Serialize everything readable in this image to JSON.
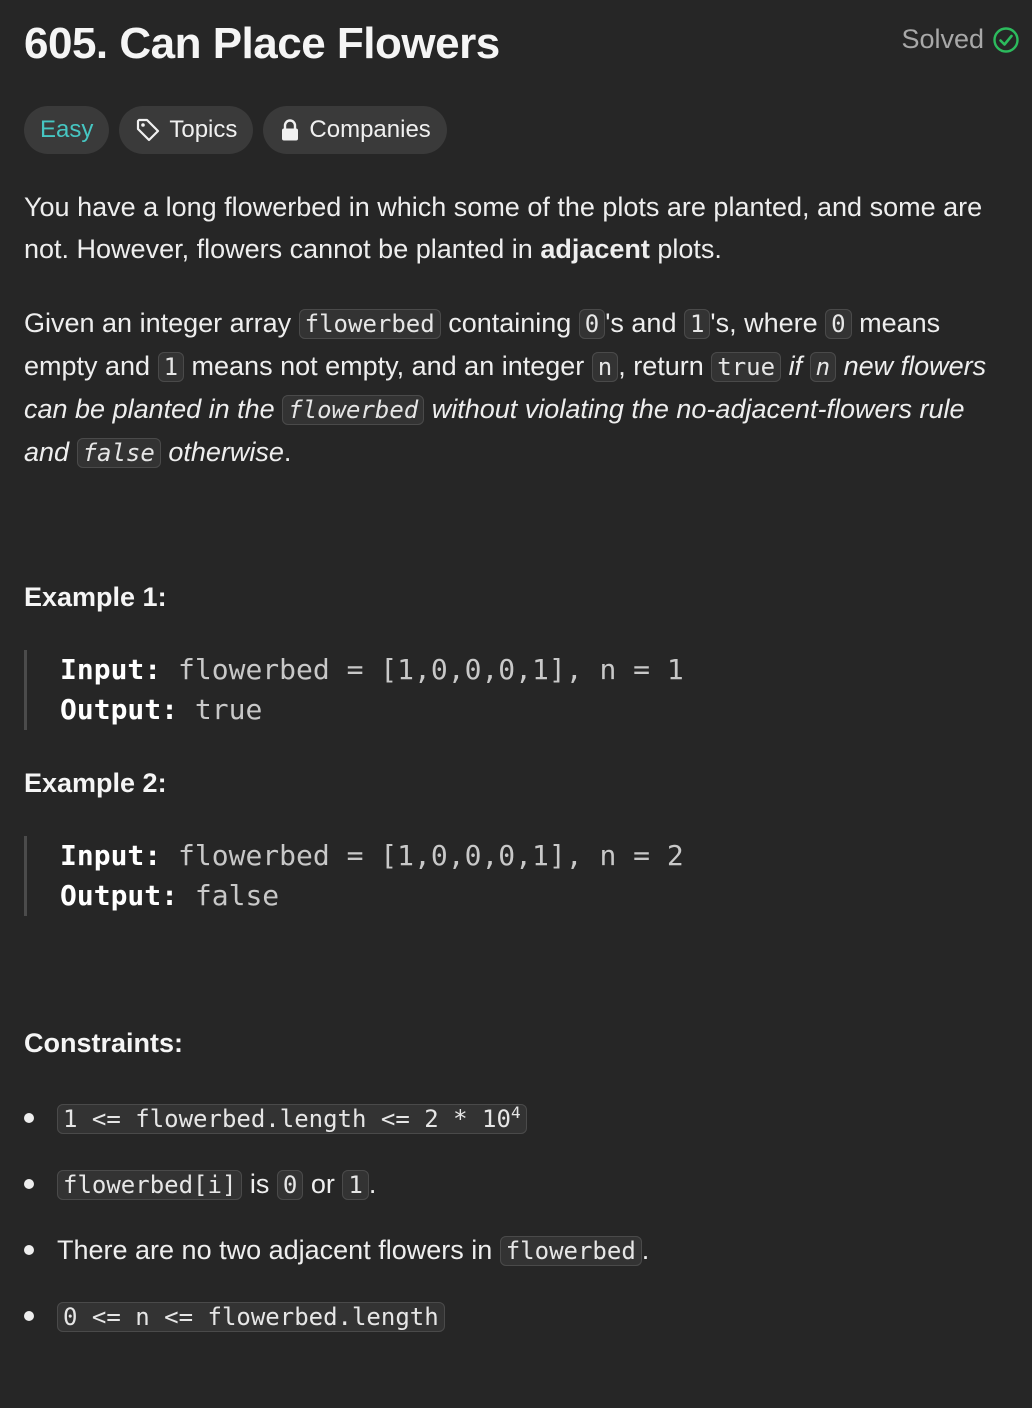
{
  "header": {
    "title": "605. Can Place Flowers",
    "status": "Solved"
  },
  "tags": {
    "difficulty": "Easy",
    "topics": "Topics",
    "companies": "Companies"
  },
  "colors": {
    "easy": "#46c6c2",
    "solved_check": "#2cbb5d",
    "background": "#262626"
  },
  "icons": {
    "solved": "check-circle-icon",
    "topics": "tag-icon",
    "companies": "lock-icon"
  },
  "description": {
    "p1_a": "You have a long flowerbed in which some of the plots are planted, and some are not. However, flowers cannot be planted in ",
    "p1_bold": "adjacent",
    "p1_b": " plots.",
    "p2_a": "Given an integer array ",
    "p2_code1": "flowerbed",
    "p2_b": " containing ",
    "p2_code2": "0",
    "p2_c": "'s and ",
    "p2_code3": "1",
    "p2_d": "'s, where ",
    "p2_code4": "0",
    "p2_e": " means empty and ",
    "p2_code5": "1",
    "p2_f": " means not empty, and an integer ",
    "p2_code6": "n",
    "p2_g": ", return ",
    "p2_code7": "true",
    "p2_h": " ",
    "p2_i_if": "if",
    "p2_code8": "n",
    "p2_i_new": " new flowers can be planted in the ",
    "p2_code9": "flowerbed",
    "p2_i_rest": " without violating the no-adjacent-flowers rule and ",
    "p2_code10": "false",
    "p2_i_end": " otherwise",
    "p2_end": "."
  },
  "examples": [
    {
      "heading": "Example 1:",
      "input_label": "Input:",
      "input_value": "flowerbed = [1,0,0,0,1], n = 1",
      "output_label": "Output:",
      "output_value": "true"
    },
    {
      "heading": "Example 2:",
      "input_label": "Input:",
      "input_value": "flowerbed = [1,0,0,0,1], n = 2",
      "output_label": "Output:",
      "output_value": "false"
    }
  ],
  "constraints": {
    "heading": "Constraints:",
    "c1_code": "1 <= flowerbed.length <= 2 * 10",
    "c1_sup": "4",
    "c2_code1": "flowerbed[i]",
    "c2_is": " is ",
    "c2_code2": "0",
    "c2_or": " or ",
    "c2_code3": "1",
    "c2_end": ".",
    "c3_text": "There are no two adjacent flowers in ",
    "c3_code": "flowerbed",
    "c3_end": ".",
    "c4_code": "0 <= n <= flowerbed.length"
  }
}
